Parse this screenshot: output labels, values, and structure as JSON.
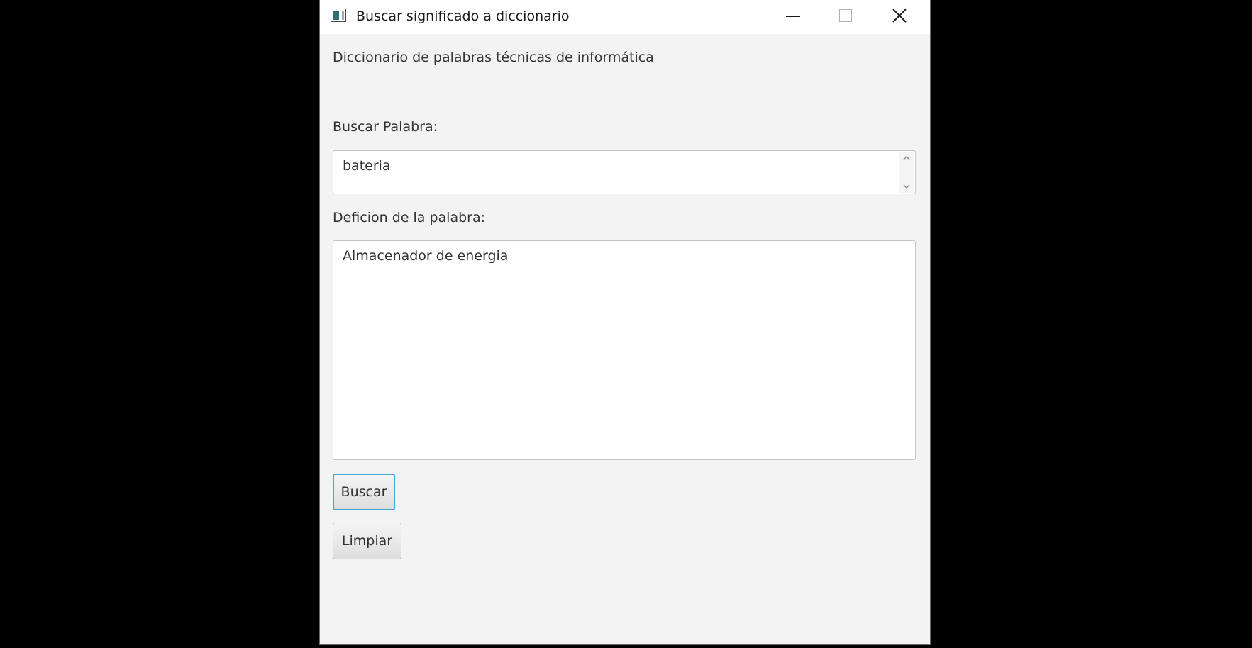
{
  "window": {
    "title": "Buscar significado a diccionario",
    "icons": {
      "app": "app-window-icon",
      "minimize": "minimize-icon",
      "maximize": "maximize-icon",
      "close": "close-icon"
    }
  },
  "form": {
    "header": "Diccionario de palabras técnicas de informática",
    "search_label": "Buscar Palabra:",
    "search_value": "bateria",
    "definition_label": "Deficion de la palabra:",
    "definition_value": "Almacenador de energia",
    "search_button": "Buscar",
    "clear_button": "Limpiar"
  },
  "colors": {
    "window_bg": "#f3f3f3",
    "focus_border": "#3fa9d8",
    "desktop_bg": "#000000"
  }
}
